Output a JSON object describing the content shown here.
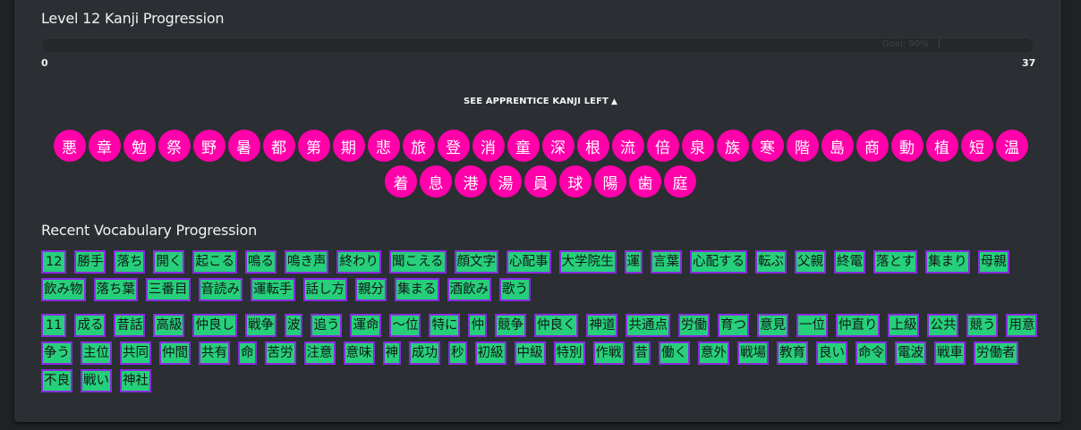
{
  "kanji_section": {
    "title": "Level 12 Kanji Progression",
    "progress": {
      "min": "0",
      "max": "37",
      "goal_label": "Goal: 90%",
      "value": 0
    },
    "toggle_label": "SEE APPRENTICE KANJI LEFT",
    "toggle_icon": "chevron-up-icon",
    "items": [
      "悪",
      "章",
      "勉",
      "祭",
      "野",
      "暑",
      "都",
      "第",
      "期",
      "悲",
      "旅",
      "登",
      "消",
      "童",
      "深",
      "根",
      "流",
      "倍",
      "泉",
      "族",
      "寒",
      "階",
      "島",
      "商",
      "動",
      "植",
      "短",
      "温",
      "着",
      "息",
      "港",
      "湯",
      "員",
      "球",
      "陽",
      "歯",
      "庭"
    ],
    "badge_color": "#ff00aa"
  },
  "vocab_section": {
    "title": "Recent Vocabulary Progression",
    "groups": [
      {
        "level": "12",
        "items": [
          "勝手",
          "落ち",
          "開く",
          "起こる",
          "鳴る",
          "鳴き声",
          "終わり",
          "聞こえる",
          "顔文字",
          "心配事",
          "大学院生",
          "運",
          "言葉",
          "心配する",
          "転ぶ",
          "父親",
          "終電",
          "落とす",
          "集まり",
          "母親",
          "飲み物",
          "落ち葉",
          "三番目",
          "音読み",
          "運転手",
          "話し方",
          "親分",
          "集まる",
          "酒飲み",
          "歌う"
        ]
      },
      {
        "level": "11",
        "items": [
          "成る",
          "昔話",
          "高級",
          "仲良し",
          "戦争",
          "波",
          "追う",
          "運命",
          "〜位",
          "特に",
          "仲",
          "競争",
          "仲良く",
          "神道",
          "共通点",
          "労働",
          "育つ",
          "意見",
          "一位",
          "仲直り",
          "上級",
          "公共",
          "競う",
          "用意",
          "争う",
          "主位",
          "共同",
          "仲間",
          "共有",
          "命",
          "苦労",
          "注意",
          "意味",
          "神",
          "成功",
          "秒",
          "初級",
          "中級",
          "特別",
          "作戦",
          "昔",
          "働く",
          "意外",
          "戦場",
          "教育",
          "良い",
          "命令",
          "電波",
          "戦車",
          "労働者",
          "不良",
          "戦い",
          "神社"
        ]
      }
    ],
    "chip_color": "#26d07a",
    "chip_border": "#8a2be2"
  }
}
